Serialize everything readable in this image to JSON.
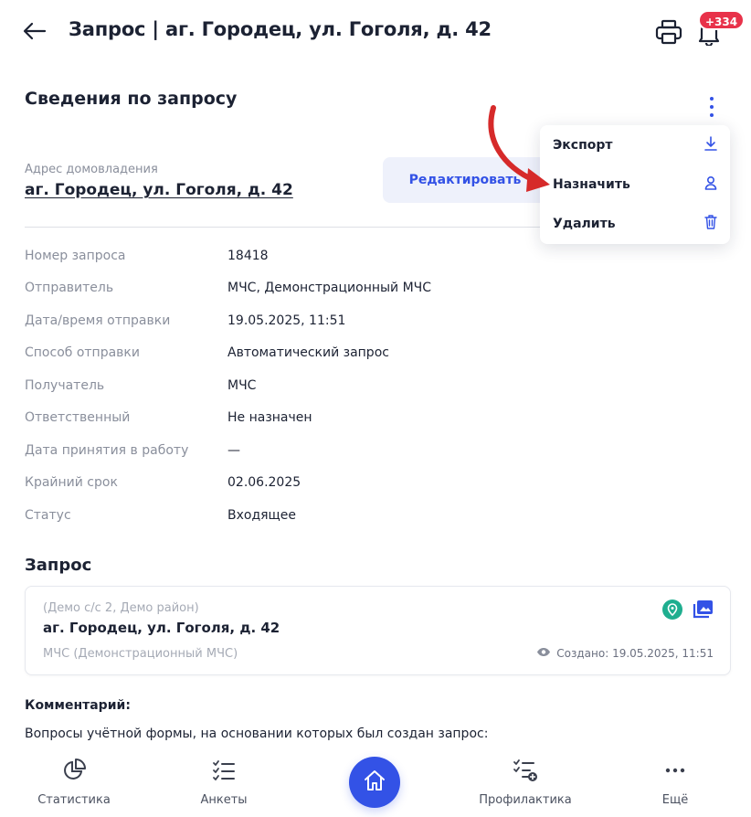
{
  "header": {
    "title": "Запрос |  аг. Городец, ул. Гоголя, д. 42",
    "notification_count": "+334"
  },
  "details": {
    "section_title": "Сведения по запросу",
    "address_label": "Адрес домовладения",
    "address_value": "аг. Городец, ул. Гоголя, д. 42",
    "edit_label": "Редактировать",
    "rows": [
      {
        "label": "Номер запроса",
        "value": "18418"
      },
      {
        "label": "Отправитель",
        "value": "МЧС, Демонстрационный МЧС"
      },
      {
        "label": "Дата/время отправки",
        "value": "19.05.2025, 11:51"
      },
      {
        "label": "Способ отправки",
        "value": "Автоматический запрос"
      },
      {
        "label": "Получатель",
        "value": "МЧС"
      },
      {
        "label": "Ответственный",
        "value": "Не назначен"
      },
      {
        "label": "Дата принятия в работу",
        "value": "—"
      },
      {
        "label": "Крайний срок",
        "value": "02.06.2025"
      },
      {
        "label": "Статус",
        "value": "Входящее"
      }
    ]
  },
  "menu": {
    "items": [
      {
        "label": "Экспорт",
        "icon": "download-icon"
      },
      {
        "label": "Назначить",
        "icon": "user-icon"
      },
      {
        "label": "Удалить",
        "icon": "trash-icon"
      }
    ]
  },
  "request": {
    "section_title": "Запрос",
    "subtitle": "(Демо с/с 2, Демо район)",
    "address": "аг. Городец, ул. Гоголя, д. 42",
    "sender": "МЧС (Демонстрационный МЧС)",
    "created": "Создано: 19.05.2025, 11:51"
  },
  "comment": {
    "label": "Комментарий:",
    "text": "Вопросы учётной формы, на основании которых был создан запрос:"
  },
  "nav": {
    "items": [
      {
        "label": "Статистика",
        "icon": "pie-chart-icon"
      },
      {
        "label": "Анкеты",
        "icon": "checklist-icon"
      },
      {
        "label": "",
        "icon": "home-icon"
      },
      {
        "label": "Профилактика",
        "icon": "checklist-add-icon"
      },
      {
        "label": "Ещё",
        "icon": "more-icon"
      }
    ]
  },
  "colors": {
    "accent": "#3352e6",
    "badge": "#e8324a",
    "pin": "#1fae8f",
    "arrow": "#d62a2a"
  }
}
